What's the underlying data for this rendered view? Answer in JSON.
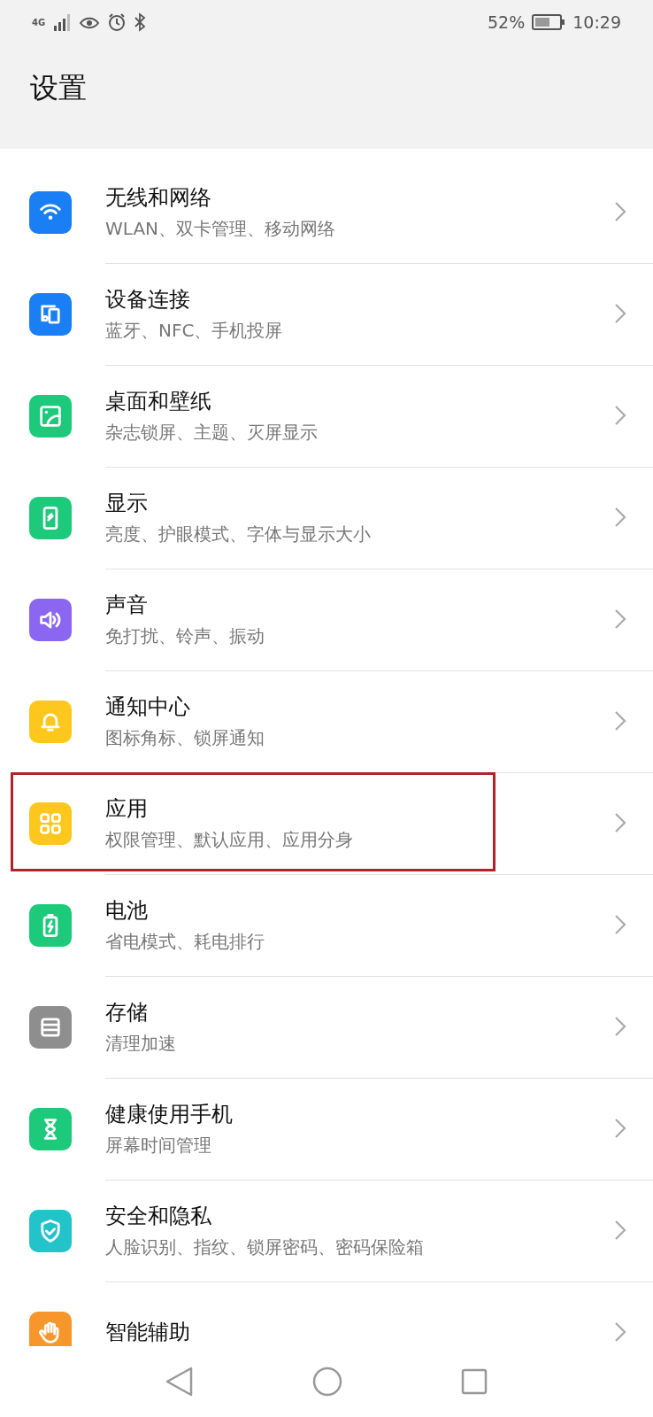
{
  "status_bar": {
    "network": "4G",
    "battery_percent": "52%",
    "time": "10:29"
  },
  "header": {
    "title": "设置"
  },
  "items": [
    {
      "title": "无线和网络",
      "subtitle": "WLAN、双卡管理、移动网络",
      "color": "#1a7ff5",
      "highlighted": false
    },
    {
      "title": "设备连接",
      "subtitle": "蓝牙、NFC、手机投屏",
      "color": "#1a7ff5",
      "highlighted": false
    },
    {
      "title": "桌面和壁纸",
      "subtitle": "杂志锁屏、主题、灭屏显示",
      "color": "#1dc97a",
      "highlighted": false
    },
    {
      "title": "显示",
      "subtitle": "亮度、护眼模式、字体与显示大小",
      "color": "#1dc97a",
      "highlighted": false
    },
    {
      "title": "声音",
      "subtitle": "免打扰、铃声、振动",
      "color": "#8b66f0",
      "highlighted": false
    },
    {
      "title": "通知中心",
      "subtitle": "图标角标、锁屏通知",
      "color": "#fdc71d",
      "highlighted": false
    },
    {
      "title": "应用",
      "subtitle": "权限管理、默认应用、应用分身",
      "color": "#fdc71d",
      "highlighted": true
    },
    {
      "title": "电池",
      "subtitle": "省电模式、耗电排行",
      "color": "#1dc97a",
      "highlighted": false
    },
    {
      "title": "存储",
      "subtitle": "清理加速",
      "color": "#8e8e8e",
      "highlighted": false
    },
    {
      "title": "健康使用手机",
      "subtitle": "屏幕时间管理",
      "color": "#1dc97a",
      "highlighted": false
    },
    {
      "title": "安全和隐私",
      "subtitle": "人脸识别、指纹、锁屏密码、密码保险箱",
      "color": "#22c3c9",
      "highlighted": false
    },
    {
      "title": "智能辅助",
      "color": "#f7962a",
      "highlighted": false
    }
  ]
}
